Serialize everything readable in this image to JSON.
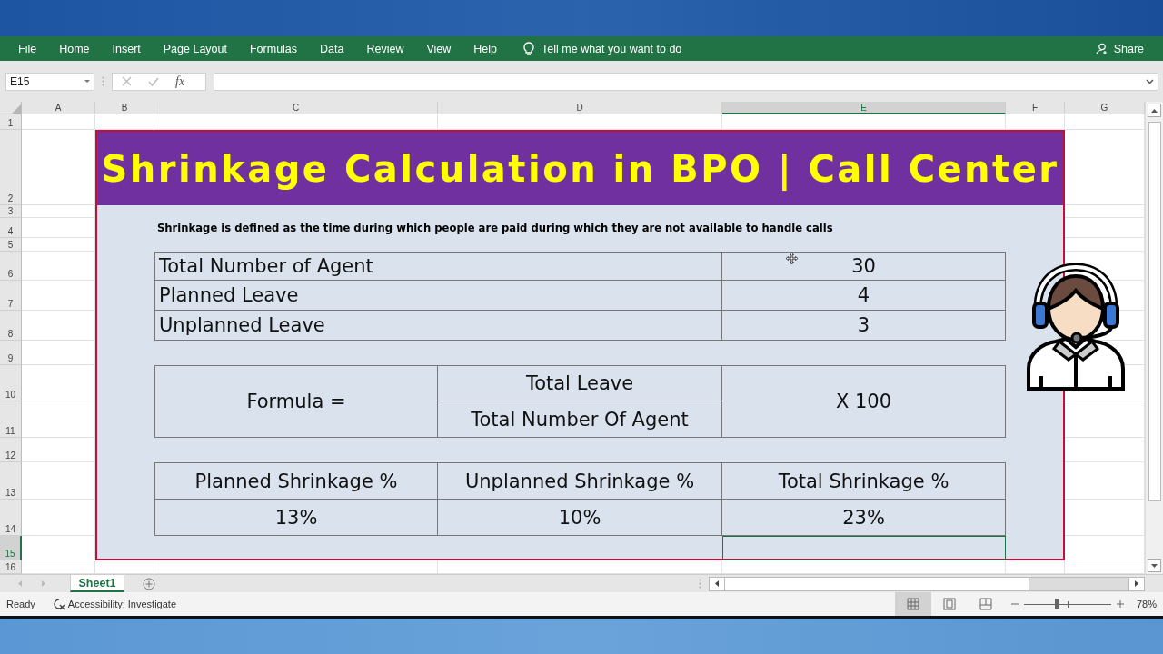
{
  "ribbon": {
    "tabs": [
      "File",
      "Home",
      "Insert",
      "Page Layout",
      "Formulas",
      "Data",
      "Review",
      "View",
      "Help"
    ],
    "tell_me": "Tell me what you want to do",
    "share": "Share"
  },
  "formula_bar": {
    "name_box": "E15",
    "function_label": "fx"
  },
  "sheet": {
    "columns": [
      {
        "label": "A",
        "selected": false
      },
      {
        "label": "B",
        "selected": false
      },
      {
        "label": "C",
        "selected": false
      },
      {
        "label": "D",
        "selected": false
      },
      {
        "label": "E",
        "selected": true
      },
      {
        "label": "F",
        "selected": false
      },
      {
        "label": "G",
        "selected": false
      }
    ],
    "rows": [
      {
        "label": "1",
        "selected": false
      },
      {
        "label": "2",
        "selected": false
      },
      {
        "label": "3",
        "selected": false
      },
      {
        "label": "4",
        "selected": false
      },
      {
        "label": "5",
        "selected": false
      },
      {
        "label": "6",
        "selected": false
      },
      {
        "label": "7",
        "selected": false
      },
      {
        "label": "8",
        "selected": false
      },
      {
        "label": "9",
        "selected": false
      },
      {
        "label": "10",
        "selected": false
      },
      {
        "label": "11",
        "selected": false
      },
      {
        "label": "12",
        "selected": false
      },
      {
        "label": "13",
        "selected": false
      },
      {
        "label": "14",
        "selected": false
      },
      {
        "label": "15",
        "selected": true
      },
      {
        "label": "16",
        "selected": false
      }
    ],
    "title": "Shrinkage Calculation in BPO | Call Center",
    "definition": "Shrinkage is defined as the time during which people are paid during which they are not available to handle calls",
    "inputs": [
      {
        "label": "Total Number of Agent",
        "value": "30"
      },
      {
        "label": "Planned Leave",
        "value": "4"
      },
      {
        "label": "Unplanned Leave",
        "value": "3"
      }
    ],
    "formula": {
      "label": "Formula =",
      "numerator": "Total Leave",
      "denominator": "Total Number Of Agent",
      "multiplier": "X 100"
    },
    "results": [
      {
        "heading": "Planned Shrinkage %",
        "value": "13%"
      },
      {
        "heading": "Unplanned Shrinkage %",
        "value": "10%"
      },
      {
        "heading": "Total Shrinkage %",
        "value": "23%"
      }
    ]
  },
  "sheet_tabs": [
    {
      "label": "Sheet1",
      "selected": true
    }
  ],
  "status_bar": {
    "ready": "Ready",
    "accessibility": "Accessibility: Investigate",
    "views": [
      {
        "kind": "normal",
        "selected": true
      },
      {
        "kind": "page-layout",
        "selected": false
      },
      {
        "kind": "page-break",
        "selected": false
      }
    ],
    "zoom_level": {
      "level": 0.38
    },
    "zoom": "78%"
  }
}
